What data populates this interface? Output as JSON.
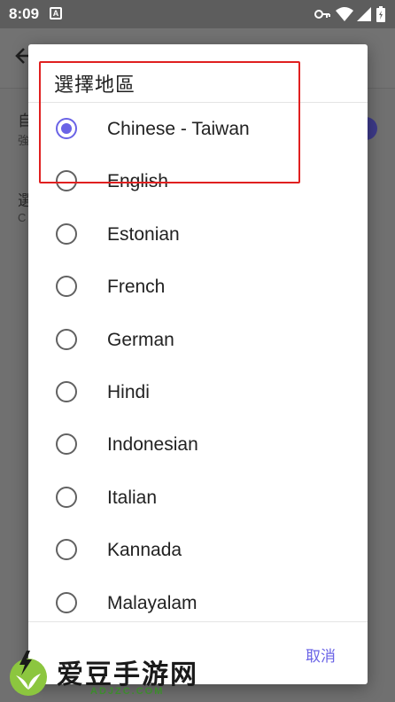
{
  "status_bar": {
    "time": "8:09",
    "app_notification": "A"
  },
  "background": {
    "row1_title": "自",
    "row1_subtitle": "強",
    "row2_title": "選",
    "row2_subtitle": "C"
  },
  "dialog": {
    "title": "選擇地區",
    "selected_index": 0,
    "regions": [
      "Chinese - Taiwan",
      "English",
      "Estonian",
      "French",
      "German",
      "Hindi",
      "Indonesian",
      "Italian",
      "Kannada",
      "Malayalam"
    ],
    "cancel_label": "取消"
  },
  "colors": {
    "accent": "#6a63e6",
    "highlight": "#e02020"
  },
  "watermark": {
    "title": "爱豆手游网",
    "domain": "ADJZC.COM"
  }
}
